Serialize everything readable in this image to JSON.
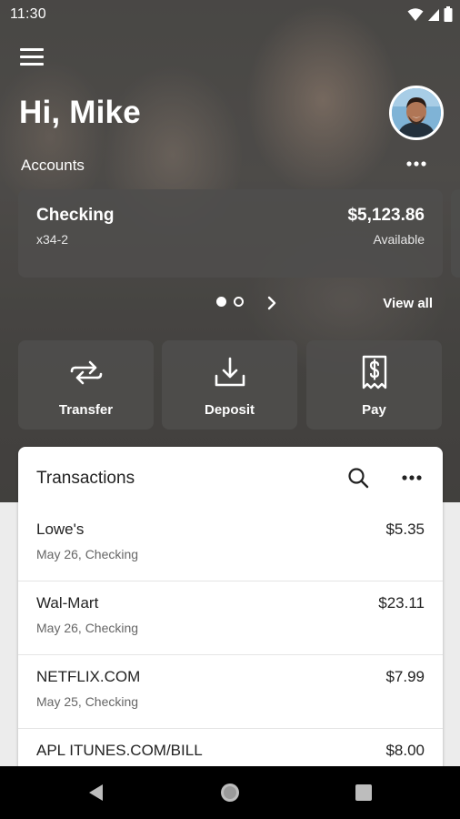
{
  "status_bar": {
    "time": "11:30"
  },
  "header": {
    "greeting": "Hi, Mike",
    "accounts_label": "Accounts"
  },
  "account": {
    "name": "Checking",
    "number": "x34-2",
    "balance": "$5,123.86",
    "balance_label": "Available"
  },
  "carousel": {
    "view_all": "View all"
  },
  "actions": [
    {
      "label": "Transfer",
      "icon": "transfer-icon"
    },
    {
      "label": "Deposit",
      "icon": "deposit-icon"
    },
    {
      "label": "Pay",
      "icon": "bill-icon"
    }
  ],
  "transactions": {
    "title": "Transactions",
    "items": [
      {
        "merchant": "Lowe's",
        "detail": "May 26, Checking",
        "amount": "$5.35"
      },
      {
        "merchant": "Wal-Mart",
        "detail": "May 26, Checking",
        "amount": "$23.11"
      },
      {
        "merchant": "NETFLIX.COM",
        "detail": "May 25, Checking",
        "amount": "$7.99"
      },
      {
        "merchant": "APL ITUNES.COM/BILL",
        "detail": "",
        "amount": "$8.00"
      }
    ]
  },
  "colors": {
    "card_bg": "#4e4d4c",
    "surface": "#ffffff",
    "page_bg": "#ececec"
  }
}
